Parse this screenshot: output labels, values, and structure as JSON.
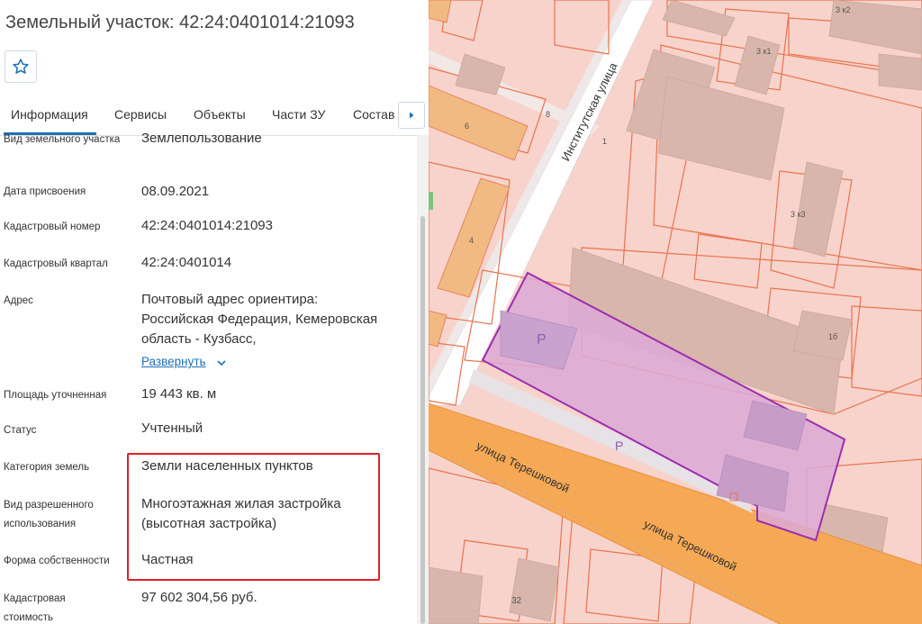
{
  "panel": {
    "title": "Земельный участок: 42:24:0401014:21093",
    "favorite_icon": "star-icon",
    "tabs": [
      "Информация",
      "Сервисы",
      "Объекты",
      "Части ЗУ",
      "Состав"
    ],
    "next_icon": "chevron-right-icon",
    "expand_link": "Развернуть",
    "rows": [
      {
        "label": "Вид земельного участка",
        "value": "Землепользование"
      },
      {
        "label": "Дата присвоения",
        "value": "08.09.2021"
      },
      {
        "label": "Кадастровый номер",
        "value": "42:24:0401014:21093"
      },
      {
        "label": "Кадастровый квартал",
        "value": "42:24:0401014"
      },
      {
        "label": "Адрес",
        "value": "Почтовый адрес ориентира: Российская Федерация, Кемеровская область - Кузбасс,"
      },
      {
        "label": "Площадь уточненная",
        "value": "19 443 кв. м"
      },
      {
        "label": "Статус",
        "value": "Учтенный"
      },
      {
        "label": "Категория земель",
        "value": "Земли населенных пунктов"
      },
      {
        "label": "Вид разрешенного использования",
        "value": "Многоэтажная жилая застройка (высотная застройка)"
      },
      {
        "label": "Форма собственности",
        "value": "Частная"
      },
      {
        "label": "Кадастровая стоимость",
        "value": "97 602 304,56 руб."
      }
    ]
  },
  "map": {
    "streets": [
      "Институтская улица",
      "улица Терешковой",
      "улица Терешковой"
    ],
    "parking_labels": [
      "P",
      "P"
    ],
    "house_numbers": [
      "6",
      "8",
      "1",
      "4",
      "3 к2",
      "3 к1",
      "3 к3",
      "1б",
      "32"
    ],
    "colors": {
      "land": "#f7d3cb",
      "parcel_border": "#e8734f",
      "street": "#f6a955",
      "selected_fill": "#dca9d6",
      "selected_border": "#9b2db0",
      "highlight": "#e0202a"
    }
  }
}
